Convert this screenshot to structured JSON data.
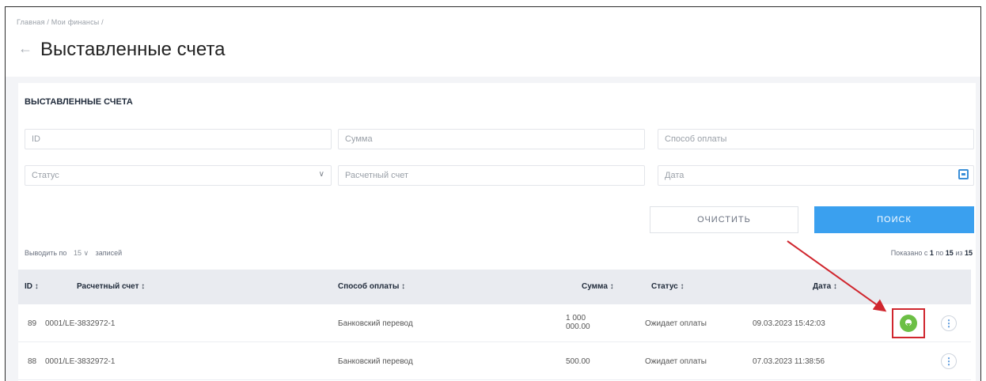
{
  "breadcrumb": "Главная / Мои финансы /",
  "title": "Выставленные счета",
  "section_title": "ВЫСТАВЛЕННЫЕ СЧЕТА",
  "filters": {
    "id_placeholder": "ID",
    "amount_placeholder": "Сумма",
    "payment_method_placeholder": "Способ оплаты",
    "status_placeholder": "Статус",
    "account_placeholder": "Расчетный счет",
    "date_placeholder": "Дата"
  },
  "buttons": {
    "clear": "ОЧИСТИТЬ",
    "search": "ПОИСК"
  },
  "pagination": {
    "prefix": "Выводить по",
    "per_page": "15",
    "suffix": "записей",
    "shown_prefix": "Показано с",
    "from": "1",
    "to_word": "по",
    "to": "15",
    "of_word": "из",
    "total": "15"
  },
  "columns": {
    "id": "ID ↕",
    "account": "Расчетный счет ↕",
    "method": "Способ оплаты ↕",
    "amount": "Сумма ↕",
    "status": "Статус ↕",
    "date": "Дата ↕"
  },
  "rows": [
    {
      "id": "89",
      "account": "0001/LE-3832972-1",
      "method": "Банковский перевод",
      "amount_line1": "1 000",
      "amount_line2": "000.00",
      "status": "Ожидает оплаты",
      "date": "09.03.2023 15:42:03",
      "has_download": true
    },
    {
      "id": "88",
      "account": "0001/LE-3832972-1",
      "method": "Банковский перевод",
      "amount_line1": "500.00",
      "amount_line2": "",
      "status": "Ожидает оплаты",
      "date": "07.03.2023 11:38:56",
      "has_download": false
    }
  ],
  "colors": {
    "accent": "#3aa0ef",
    "download": "#6cbf45",
    "highlight": "#d0262e"
  }
}
